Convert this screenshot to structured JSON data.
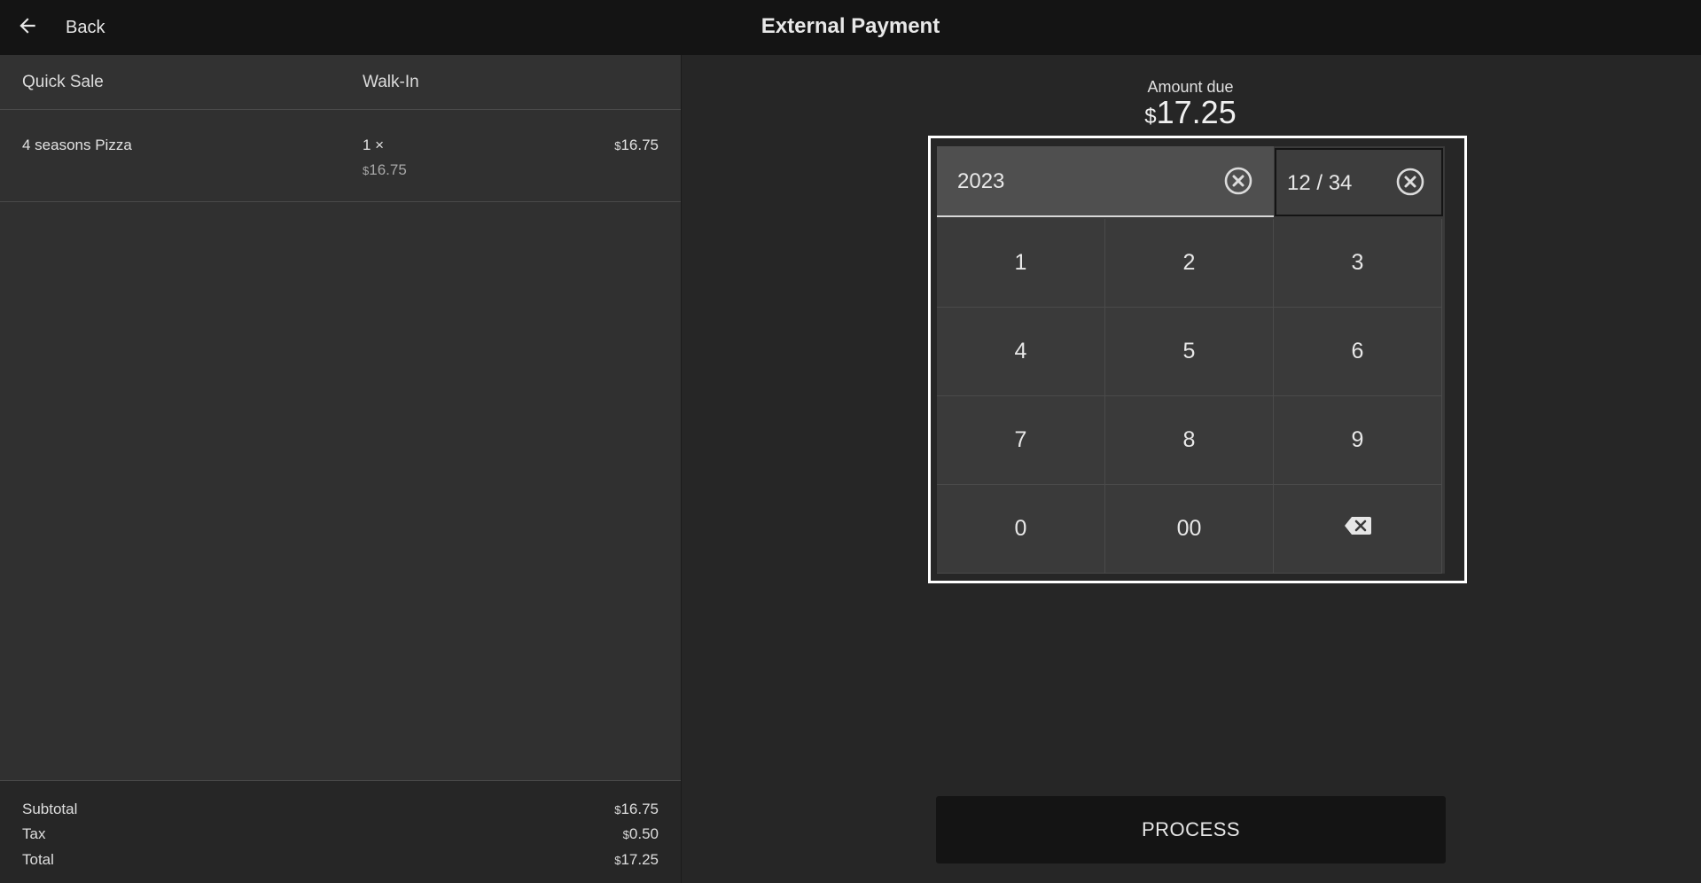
{
  "header": {
    "back_label": "Back",
    "title": "External Payment",
    "back_icon": "arrow-left-icon"
  },
  "order": {
    "type": "Quick Sale",
    "customer": "Walk-In",
    "items": [
      {
        "name": "4 seasons Pizza",
        "qty": "1 ×",
        "unit_currency": "$",
        "unit_amount": "16.75",
        "total_currency": "$",
        "total_amount": "16.75"
      }
    ],
    "totals": {
      "subtotal_label": "Subtotal",
      "subtotal_currency": "$",
      "subtotal_amount": "16.75",
      "tax_label": "Tax",
      "tax_currency": "$",
      "tax_amount": "0.50",
      "total_label": "Total",
      "total_currency": "$",
      "total_amount": "17.25"
    }
  },
  "payment": {
    "amount_due_label": "Amount due",
    "amount_currency": "$",
    "amount_value": "17.25",
    "main_field_value": "2023",
    "expiry_field_value": "12 / 34",
    "clear_icon": "close-circle-icon",
    "keys": [
      "1",
      "2",
      "3",
      "4",
      "5",
      "6",
      "7",
      "8",
      "9",
      "0",
      "00"
    ],
    "backspace_icon": "backspace-icon",
    "process_label": "PROCESS"
  },
  "colors": {
    "top_bar": "#141414",
    "left_panel": "#303030",
    "right_panel": "#262626",
    "keypad_bg": "#3a3a3a",
    "focus_frame": "#ffffff",
    "process_bg": "#141414"
  }
}
